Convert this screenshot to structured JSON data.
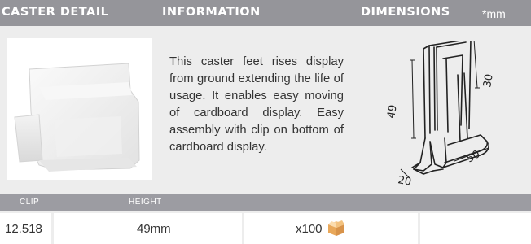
{
  "header": {
    "caster_detail": "CASTER DETAIL",
    "information": "INFORMATION",
    "dimensions": "DIMENSIONS",
    "unit": "*mm"
  },
  "description": "This caster feet rises display from ground extending the life of usage. It enables easy moving of cardboard display. Easy assembly with clip on bottom of cardboard display.",
  "dimensions": {
    "height": "49",
    "clip": "30",
    "length": "50",
    "width": "20"
  },
  "table": {
    "columns": [
      "CLIP",
      "HEIGHT"
    ],
    "row": {
      "clip": "12.518",
      "height": "49mm",
      "quantity": "x100"
    }
  },
  "icons": {
    "product_photo": "caster-photo",
    "dimension_drawing": "caster-line-drawing",
    "quantity": "cardboard-box-icon"
  },
  "colors": {
    "header_bg": "#95959a",
    "panel_bg": "#ededed",
    "box_icon": "#f0b469"
  }
}
